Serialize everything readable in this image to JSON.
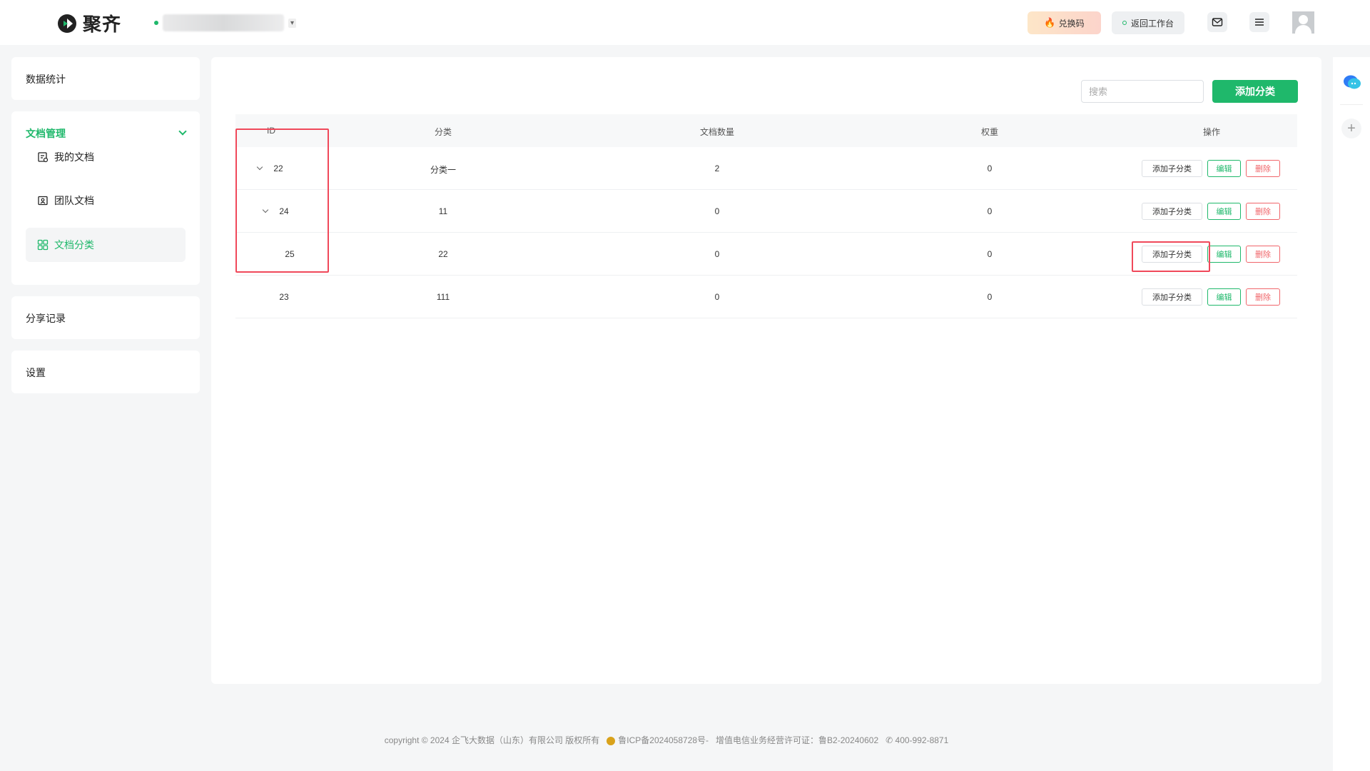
{
  "header": {
    "logo_text": "聚齐",
    "redeem_label": "兑换码",
    "back_label": "返回工作台"
  },
  "sidebar": {
    "stats": "数据统计",
    "docs_manage": "文档管理",
    "my_docs": "我的文档",
    "team_docs": "团队文档",
    "doc_categories": "文档分类",
    "share_records": "分享记录",
    "settings": "设置"
  },
  "toolbar": {
    "search_placeholder": "搜索",
    "add_category": "添加分类"
  },
  "table": {
    "columns": [
      "ID",
      "分类",
      "文档数量",
      "权重",
      "操作"
    ],
    "rows": [
      {
        "id": "22",
        "name": "分类一",
        "count": "2",
        "weight": "0"
      },
      {
        "id": "24",
        "name": "11",
        "count": "0",
        "weight": "0"
      },
      {
        "id": "25",
        "name": "22",
        "count": "0",
        "weight": "0"
      },
      {
        "id": "23",
        "name": "111",
        "count": "0",
        "weight": "0"
      }
    ],
    "actions": {
      "add_sub": "添加子分类",
      "edit": "编辑",
      "delete": "删除"
    }
  },
  "footer": {
    "copyright": "copyright © 2024 企飞大数据（山东）有限公司 版权所有",
    "icp": "鲁ICP备2024058728号-",
    "license": "增值电信业务经营许可证：鲁B2-20240602",
    "phone": "400-992-8871"
  },
  "colors": {
    "accent": "#1fb86b",
    "danger": "#f0656a",
    "highlight": "#f0485a"
  }
}
